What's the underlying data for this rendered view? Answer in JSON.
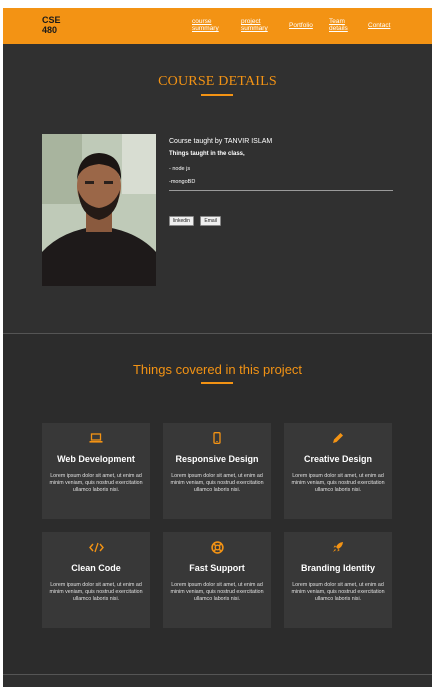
{
  "nav": {
    "logo": "CSE 480",
    "links": [
      "course summary",
      "project summary",
      "Portfolio",
      "Team details",
      "Contact"
    ]
  },
  "course": {
    "title": "COURSE DETAILS",
    "taught_by": "Course taught by TANVIR ISLAM",
    "things_label": "Things taught in the class,",
    "items": [
      "- node js",
      "-mongoBD"
    ],
    "buttons": [
      "linkedin",
      "Email"
    ]
  },
  "services": {
    "title": "Things covered in this project",
    "cards": [
      {
        "icon": "laptop-icon",
        "title": "Web Development",
        "desc": "Lorem ipsum dolor sit amet, ut enim ad minim veniam, quis nostrud exercitation ullamco laboris nisi."
      },
      {
        "icon": "mobile-icon",
        "title": "Responsive Design",
        "desc": "Lorem ipsum dolor sit amet, ut enim ad minim veniam, quis nostrud exercitation ullamco laboris nisi."
      },
      {
        "icon": "pencil-icon",
        "title": "Creative Design",
        "desc": "Lorem ipsum dolor sit amet, ut enim ad minim veniam, quis nostrud exercitation ullamco laboris nisi."
      },
      {
        "icon": "code-icon",
        "title": "Clean Code",
        "desc": "Lorem ipsum dolor sit amet, ut enim ad minim veniam, quis nostrud exercitation ullamco laboris nisi."
      },
      {
        "icon": "life-ring-icon",
        "title": "Fast Support",
        "desc": "Lorem ipsum dolor sit amet, ut enim ad minim veniam, quis nostrud exercitation ullamco laboris nisi."
      },
      {
        "icon": "rocket-icon",
        "title": "Branding Identity",
        "desc": "Lorem ipsum dolor sit amet, ut enim ad minim veniam, quis nostrud exercitation ullamco laboris nisi."
      }
    ]
  },
  "colors": {
    "accent": "#f39314",
    "background": "#2f2f2f",
    "card": "#383838"
  }
}
